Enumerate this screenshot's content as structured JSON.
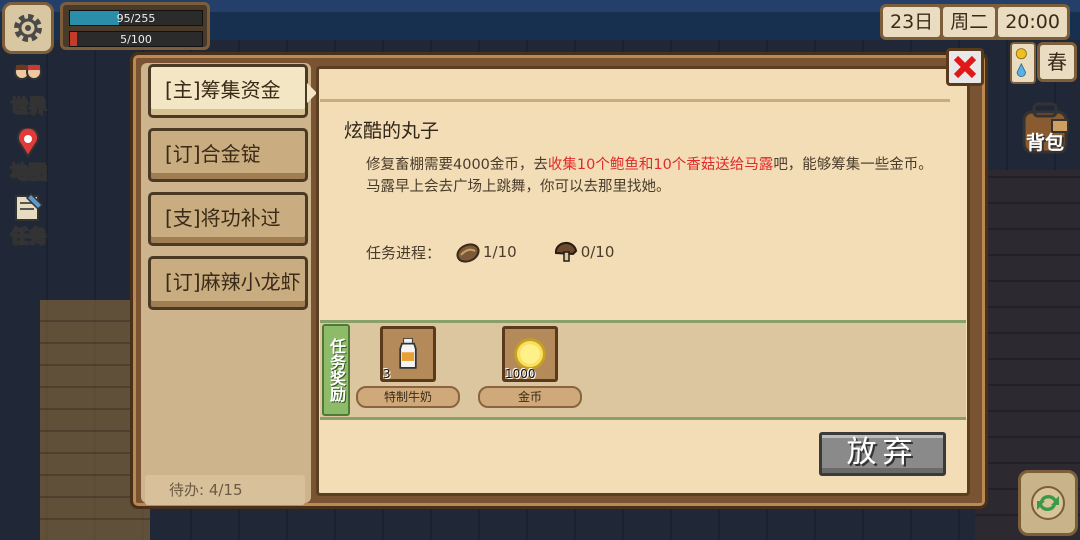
{
  "hud": {
    "hp": "95/255",
    "hp_fraction": 0.37,
    "stamina": "5/100",
    "stamina_fraction": 0.05,
    "side_buttons": [
      "世界",
      "地图",
      "任务"
    ],
    "date": "23日",
    "weekday": "周二",
    "time": "20:00",
    "season": "春",
    "bag_label": "背包"
  },
  "tasks": [
    {
      "label": "[主]筹集资金",
      "active": true
    },
    {
      "label": "[订]合金锭",
      "active": false
    },
    {
      "label": "[支]将功补过",
      "active": false
    },
    {
      "label": "[订]麻辣小龙虾",
      "active": false
    }
  ],
  "pending": "待办:  4/15",
  "detail": {
    "title": "炫酷的丸子",
    "desc_prefix": "修复畜棚需要4000金币，去",
    "desc_highlight": "收集10个鲍鱼和10个香菇送给马露",
    "desc_suffix": "吧，能够筹集一些金币。",
    "desc_line2": "马露早上会去广场上跳舞，你可以去那里找她。",
    "progress_label": "任务进程：",
    "progress": [
      {
        "icon": "abalone-icon",
        "value": "1/10"
      },
      {
        "icon": "mushroom-icon",
        "value": "0/10"
      }
    ]
  },
  "rewards": {
    "tag": "任务奖励",
    "items": [
      {
        "name": "特制牛奶",
        "qty": "3",
        "icon": "milk-bottle-icon"
      },
      {
        "name": "金币",
        "qty": "1000",
        "icon": "gold-coin-icon"
      }
    ]
  },
  "abandon_label": "放弃",
  "colors": {
    "highlight": "#e02a2a",
    "panel": "#f3ddb6",
    "frame": "#7a5432"
  }
}
